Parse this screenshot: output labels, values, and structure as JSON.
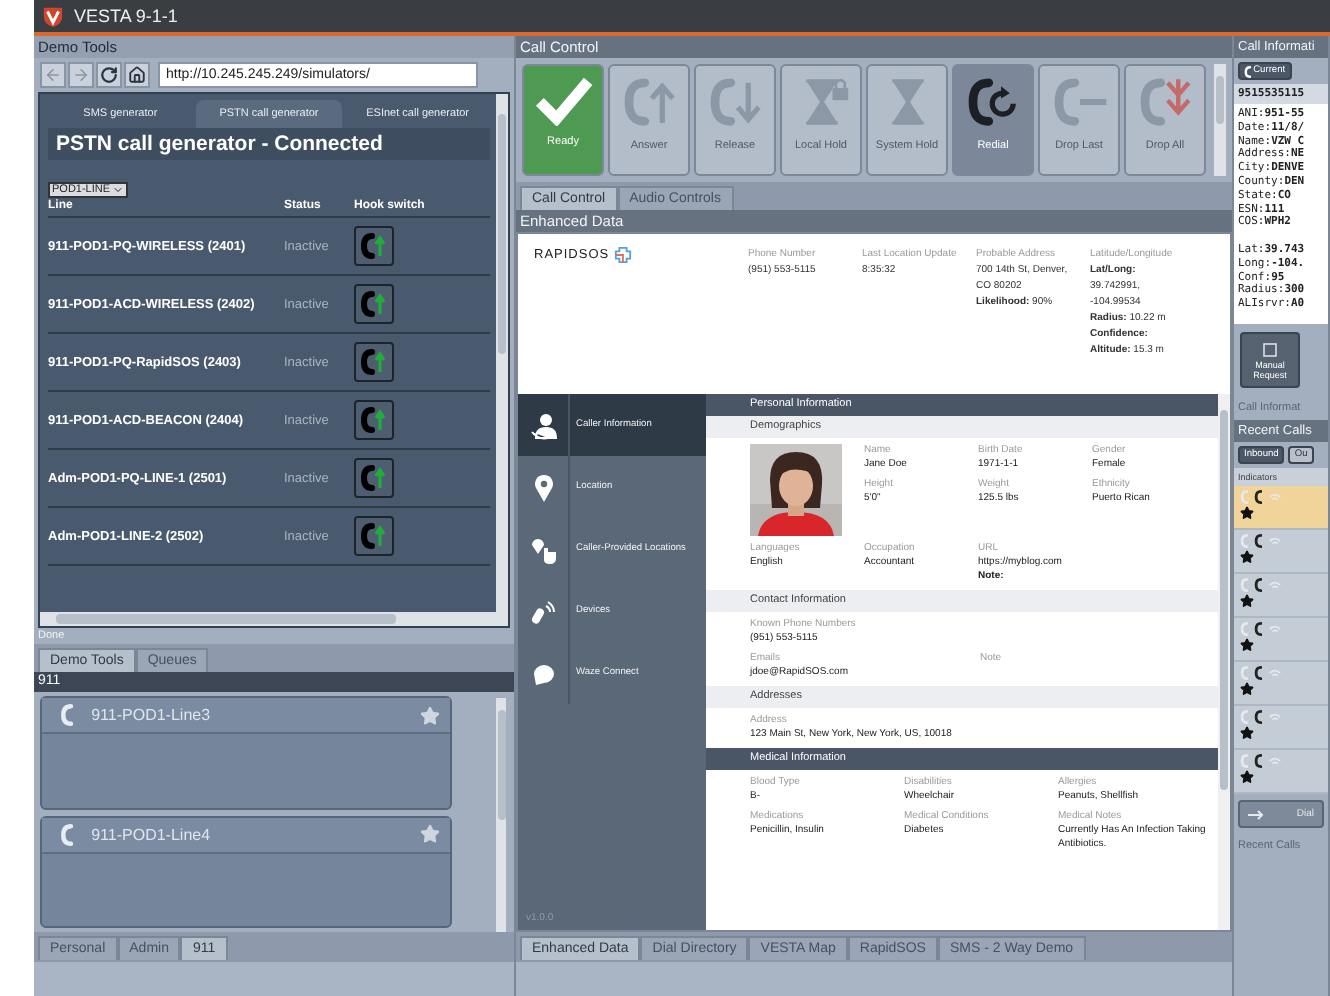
{
  "window": {
    "title": "VESTA 9-1-1"
  },
  "demo_tools": {
    "title": "Demo Tools",
    "url": "http://10.245.245.249/simulators/",
    "tabs": [
      {
        "label": "SMS generator",
        "selected": false
      },
      {
        "label": "PSTN call generator",
        "selected": true
      },
      {
        "label": "ESInet call generator",
        "selected": false
      }
    ],
    "heading": "PSTN call generator - Connected",
    "select": "POD1-LINE",
    "columns": [
      "Line",
      "Status",
      "Hook switch"
    ],
    "rows": [
      {
        "line": "911-POD1-PQ-WIRELESS (2401)",
        "status": "Inactive"
      },
      {
        "line": "911-POD1-ACD-WIRELESS (2402)",
        "status": "Inactive"
      },
      {
        "line": "911-POD1-PQ-RapidSOS (2403)",
        "status": "Inactive"
      },
      {
        "line": "911-POD1-ACD-BEACON (2404)",
        "status": "Inactive"
      },
      {
        "line": "Adm-POD1-PQ-LINE-1 (2501)",
        "status": "Inactive"
      },
      {
        "line": "Adm-POD1-LINE-2 (2502)",
        "status": "Inactive"
      }
    ],
    "status": "Done"
  },
  "left_tabs": [
    {
      "label": "Demo Tools",
      "selected": true
    },
    {
      "label": "Queues",
      "selected": false
    }
  ],
  "queues": {
    "title": "911",
    "lines": [
      {
        "name": "911-POD1-Line3"
      },
      {
        "name": "911-POD1-Line4"
      }
    ]
  },
  "queue_tabs": [
    {
      "label": "Personal",
      "selected": false
    },
    {
      "label": "Admin",
      "selected": false
    },
    {
      "label": "911",
      "selected": true
    }
  ],
  "call_control": {
    "title": "Call Control",
    "buttons": [
      {
        "label": "Ready",
        "kind": "ready",
        "disabled": false
      },
      {
        "label": "Answer",
        "kind": "answer",
        "disabled": true
      },
      {
        "label": "Release",
        "kind": "release",
        "disabled": true
      },
      {
        "label": "Local Hold",
        "kind": "local_hold",
        "disabled": true
      },
      {
        "label": "System Hold",
        "kind": "system_hold",
        "disabled": true
      },
      {
        "label": "Redial",
        "kind": "redial",
        "disabled": false
      },
      {
        "label": "Drop Last",
        "kind": "drop_last",
        "disabled": true
      },
      {
        "label": "Drop All",
        "kind": "drop_all",
        "disabled": true
      }
    ],
    "tabs": [
      {
        "label": "Call Control",
        "selected": true
      },
      {
        "label": "Audio Controls",
        "selected": false
      }
    ]
  },
  "enhanced_data": {
    "title": "Enhanced Data",
    "logo": "RAPIDSOS",
    "summary": [
      {
        "label": "Phone Number",
        "lines": [
          "(951) 553-5115"
        ]
      },
      {
        "label": "Last Location Update",
        "lines": [
          "8:35:32"
        ]
      },
      {
        "label": "Probable Address",
        "lines": [
          "700 14th St, Denver,",
          "CO 80202",
          "**Likelihood:** 90%"
        ]
      },
      {
        "label": "Latitude/Longitude",
        "lines": [
          "**Lat/Long:**",
          "39.742991,",
          "-104.99534",
          "**Radius:** 10.22 m",
          "**Confidence:**",
          "**Altitude:** 15.3 m"
        ]
      }
    ],
    "nav": [
      {
        "label": "Caller Information",
        "kind": "caller",
        "selected": true
      },
      {
        "label": "Location",
        "kind": "location",
        "selected": false
      },
      {
        "label": "Caller-Provided Locations",
        "kind": "pointer",
        "selected": false
      },
      {
        "label": "Devices",
        "kind": "device",
        "selected": false
      },
      {
        "label": "Waze Connect",
        "kind": "waze",
        "selected": false
      }
    ],
    "version": "v1.0.0",
    "sections": [
      {
        "kind": "major",
        "title": "Personal Information"
      },
      {
        "kind": "minor",
        "title": "Demographics"
      },
      {
        "kind": "profile",
        "fields": [
          {
            "label": "Name",
            "value": "Jane Doe"
          },
          {
            "label": "Birth Date",
            "value": "1971-1-1"
          },
          {
            "label": "Gender",
            "value": "Female"
          },
          {
            "label": "Height",
            "value": "5'0\""
          },
          {
            "label": "Weight",
            "value": "125.5 lbs"
          },
          {
            "label": "Ethnicity",
            "value": "Puerto Rican"
          }
        ],
        "extra": [
          {
            "label": "Languages",
            "value": "English"
          },
          {
            "label": "Occupation",
            "value": "Accountant"
          },
          {
            "label": "URL",
            "value": "https://myblog.com",
            "note": "Note:"
          }
        ]
      },
      {
        "kind": "minor",
        "title": "Contact Information"
      },
      {
        "kind": "wide",
        "rows": [
          [
            {
              "label": "Known Phone Numbers",
              "value": "(951) 553-5115"
            }
          ],
          [
            {
              "label": "Emails",
              "value": "jdoe@RapidSOS.com"
            },
            {
              "label": "Note"
            }
          ]
        ]
      },
      {
        "kind": "minor",
        "title": "Addresses"
      },
      {
        "kind": "wide",
        "rows": [
          [
            {
              "label": "Address",
              "value": "123 Main St, New York, New York, US, 10018"
            }
          ]
        ]
      },
      {
        "kind": "major",
        "title": "Medical Information"
      },
      {
        "kind": "narrow",
        "rows": [
          [
            {
              "label": "Blood Type",
              "value": "B-"
            },
            {
              "label": "Disabilities",
              "value": "Wheelchair"
            },
            {
              "label": "Allergies",
              "value": "Peanuts, Shellfish"
            }
          ],
          [
            {
              "label": "Medications",
              "value": "Penicillin, Insulin"
            },
            {
              "label": "Medical Conditions",
              "value": "Diabetes"
            },
            {
              "label": "Medical Notes",
              "value": "Currently Has An Infection Taking Antibiotics."
            }
          ]
        ]
      }
    ]
  },
  "center_tabs": [
    {
      "label": "Enhanced Data",
      "selected": true
    },
    {
      "label": "Dial Directory",
      "selected": false
    },
    {
      "label": "VESTA Map",
      "selected": false
    },
    {
      "label": "RapidSOS",
      "selected": false
    },
    {
      "label": "SMS - 2 Way Demo",
      "selected": false
    }
  ],
  "call_info": {
    "title": "Call Informati",
    "tabs": [
      {
        "label": "Current",
        "selected": true
      }
    ],
    "number": "9515535115",
    "line_groups": [
      [
        "ANI:**951-55**",
        "Date:**11/8/**",
        "Name:**VZW C**",
        "Address:**NE**",
        "City:**DENVE**",
        "County:**DEN**",
        "State:**CO**",
        "ESN:**111**",
        "COS:**WPH2**"
      ],
      [
        "Lat:**39.743**",
        "Long:**-104.**",
        "Conf:**95**",
        "Radius:**300**",
        "ALIsrvr:**A0**"
      ]
    ],
    "button": "Manual Request",
    "tab": "Call Informat"
  },
  "recent_calls": {
    "title": "Recent Calls",
    "tabs": [
      {
        "label": "Inbound",
        "selected": true
      },
      {
        "label": "Ou",
        "selected": false
      }
    ],
    "column": "Indicators",
    "rows": [
      {
        "selected": true
      },
      {
        "selected": false
      },
      {
        "selected": false
      },
      {
        "selected": false
      },
      {
        "selected": false
      },
      {
        "selected": false
      },
      {
        "selected": false
      }
    ],
    "button": "Dial",
    "tab": "Recent Calls"
  }
}
